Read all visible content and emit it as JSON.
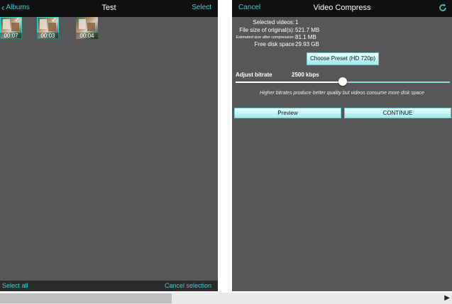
{
  "left_pane": {
    "nav": {
      "back_label": "Albums",
      "title": "Test",
      "select_label": "Select"
    },
    "thumbnails": [
      {
        "duration": "00:07",
        "selected": true
      },
      {
        "duration": "00:03",
        "selected": true
      },
      {
        "duration": "00:04",
        "selected": false
      }
    ],
    "bottom": {
      "select_all": "Select all",
      "cancel_selection": "Cancel selection"
    }
  },
  "right_pane": {
    "nav": {
      "cancel_label": "Cancel",
      "title": "Video Compress"
    },
    "info": {
      "selected_videos_label": "Selected videos:",
      "selected_videos_value": "1",
      "original_size_label": "File size of original(s):",
      "original_size_value": "521.7 MB",
      "estimated_size_label": "Estimated size after compression:",
      "estimated_size_value": "81.1 MB",
      "free_space_label": "Free disk space",
      "free_space_value": "29.93 GB"
    },
    "preset_button": "Choose Preset (HD 720p)",
    "bitrate": {
      "label": "Adjust bitrate",
      "value": "2500 kbps",
      "slider_fraction": 0.5
    },
    "hint": "Higher bitrates produce better quality but videos consume more disk space",
    "preview_button": "Preview",
    "continue_button": "CONTINUE"
  },
  "colors": {
    "accent": "#3ad0d0",
    "pane_bg": "#575757",
    "bar_bg": "#101010"
  },
  "icons": {
    "back": "chevron-left-icon",
    "refresh": "refresh-icon",
    "check": "checkmark-icon",
    "scroll_right": "arrow-right-icon"
  }
}
